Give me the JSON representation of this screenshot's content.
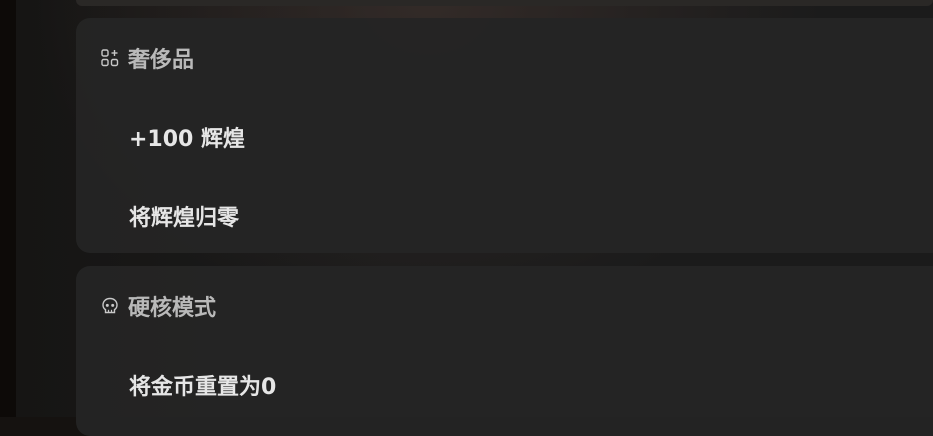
{
  "sections": [
    {
      "title": "奢侈品",
      "icon": "grid-plus-icon",
      "items": [
        "+100 辉煌",
        "将辉煌归零"
      ]
    },
    {
      "title": "硬核模式",
      "icon": "skull-icon",
      "items": [
        "将金币重置为0"
      ]
    }
  ]
}
